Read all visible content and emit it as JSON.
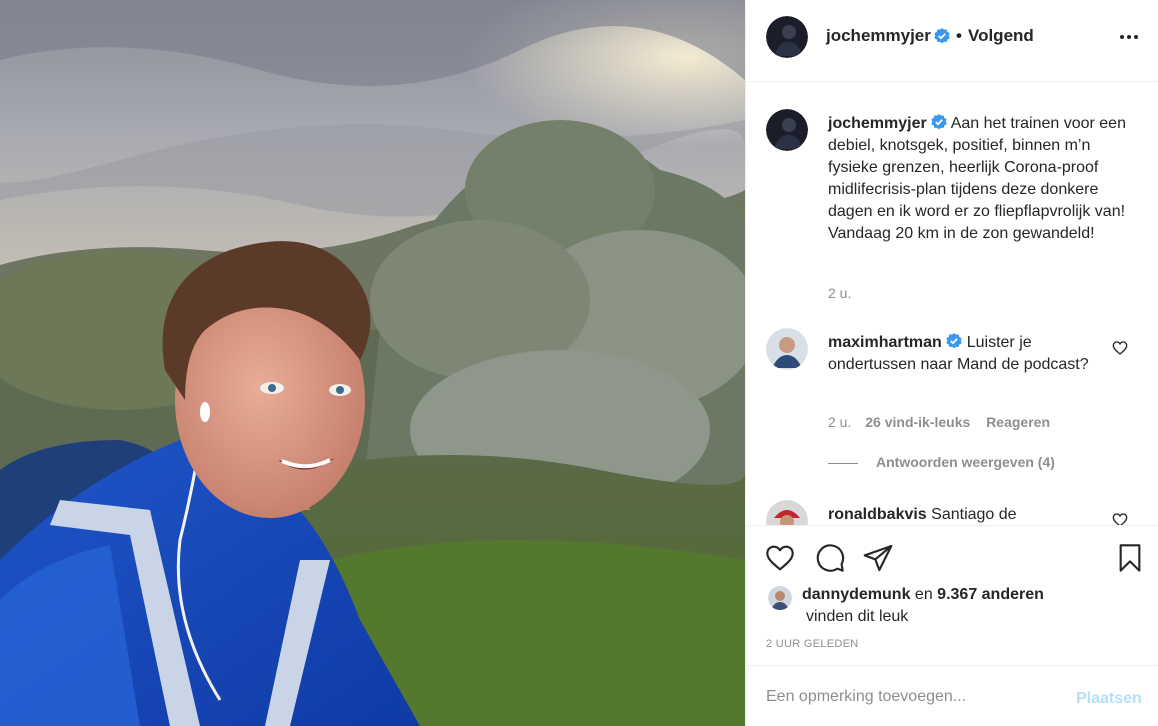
{
  "post_author": {
    "username": "jochemmyjer",
    "follow_status": "Volgend",
    "dot": "•",
    "avatar_icon": "profile-avatar"
  },
  "caption": {
    "username": "jochemmyjer",
    "text": "Aan het trainen voor een debiel, knotsgek, positief, binnen m’n fysieke grenzen, heerlijk Corona-proof midlifecrisis-plan tijdens deze donkere dagen en ik word er zo fliepflapvrolijk van! Vandaag 20 km in de zon gewandeld!",
    "time": "2 u."
  },
  "comments": [
    {
      "username": "maximhartman",
      "verified": true,
      "text": "Luister je ondertussen naar Mand de podcast?",
      "time": "2 u.",
      "likes": "26 vind-ik-leuks",
      "reply_label": "Reageren",
      "view_replies": "Antwoorden weergeven (4)"
    },
    {
      "username": "ronaldbakvis",
      "verified": false,
      "text": "Santiago de"
    }
  ],
  "actions": {
    "like_icon": "heart-icon",
    "comment_icon": "comment-icon",
    "share_icon": "share-icon",
    "save_icon": "bookmark-icon"
  },
  "likes": {
    "first_user": "dannydemunk",
    "connector": "en",
    "others": "9.367 anderen",
    "suffix": "vinden dit leuk"
  },
  "timestamp": "2 UUR GELEDEN",
  "add_comment": {
    "placeholder": "Een opmerking toevoegen...",
    "post_label": "Plaatsen"
  },
  "colors": {
    "verified": "#3897f0",
    "post_button_disabled": "#b2dffc",
    "muted_text": "#8e8e8e",
    "text": "#262626",
    "border": "#efefef"
  }
}
